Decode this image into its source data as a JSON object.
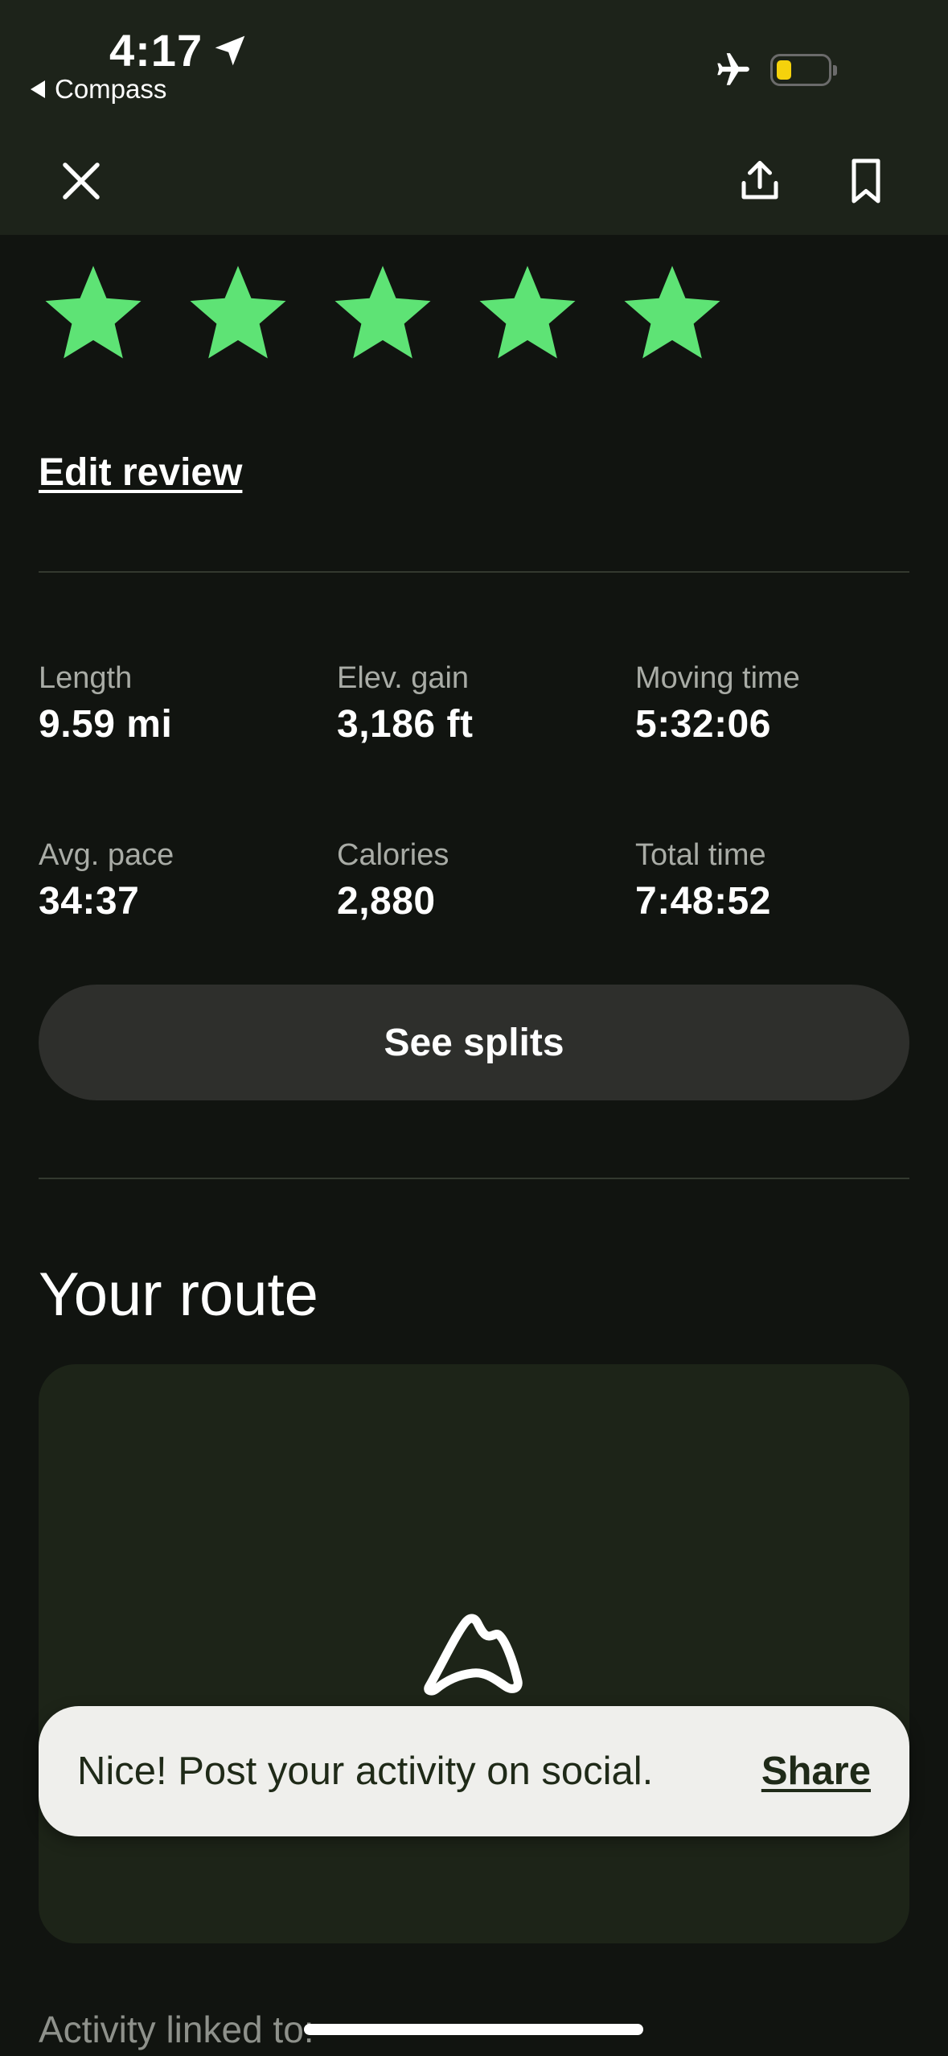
{
  "status_bar": {
    "time": "4:17",
    "back_app": "Compass",
    "battery_color": "#f5d20c"
  },
  "header": {
    "close_icon": "close-icon",
    "share_icon": "share-icon",
    "bookmark_icon": "bookmark-icon"
  },
  "review": {
    "rating": 5,
    "max_rating": 5,
    "star_color": "#5ee375",
    "edit_label": "Edit review"
  },
  "stats": [
    {
      "label": "Length",
      "value": "9.59 mi"
    },
    {
      "label": "Elev. gain",
      "value": "3,186 ft"
    },
    {
      "label": "Moving time",
      "value": "5:32:06"
    },
    {
      "label": "Avg. pace",
      "value": "34:37"
    },
    {
      "label": "Calories",
      "value": "2,880"
    },
    {
      "label": "Total time",
      "value": "7:48:52"
    }
  ],
  "splits_button": "See splits",
  "route": {
    "heading": "Your route"
  },
  "toast": {
    "message": "Nice! Post your activity on social.",
    "action": "Share"
  },
  "footer": {
    "linked_text": "Activity linked to:"
  }
}
